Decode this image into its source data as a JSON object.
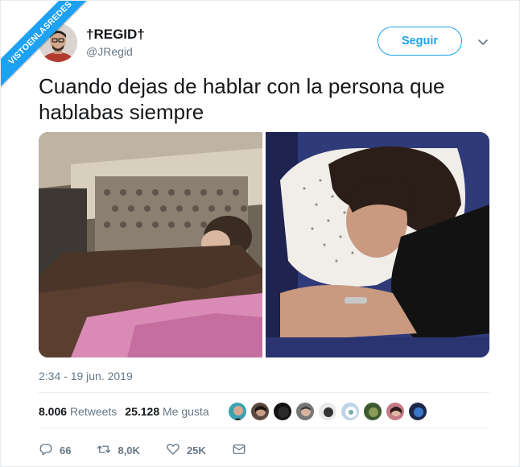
{
  "watermark": {
    "text": "VISTOENLASREDES"
  },
  "author": {
    "display_name": "†REGID†",
    "handle": "@JRegid"
  },
  "follow_button": {
    "label": "Seguir"
  },
  "tweet": {
    "text": "Cuando dejas de hablar con la persona que hablabas siempre",
    "timestamp": "2:34 - 19 jun. 2019"
  },
  "stats": {
    "retweets_count": "8.006",
    "retweets_label": "Retweets",
    "likes_count": "25.128",
    "likes_label": "Me gusta"
  },
  "actions": {
    "replies": "66",
    "retweets": "8,0K",
    "likes": "25K"
  },
  "colors": {
    "accent": "#1da1f2",
    "secondary_text": "#657786",
    "primary_text": "#14171a",
    "border": "#e6ecf0"
  },
  "icons": {
    "menu": "chevron-down-icon",
    "reply": "reply-icon",
    "retweet": "retweet-icon",
    "like": "heart-icon",
    "message": "envelope-icon"
  }
}
